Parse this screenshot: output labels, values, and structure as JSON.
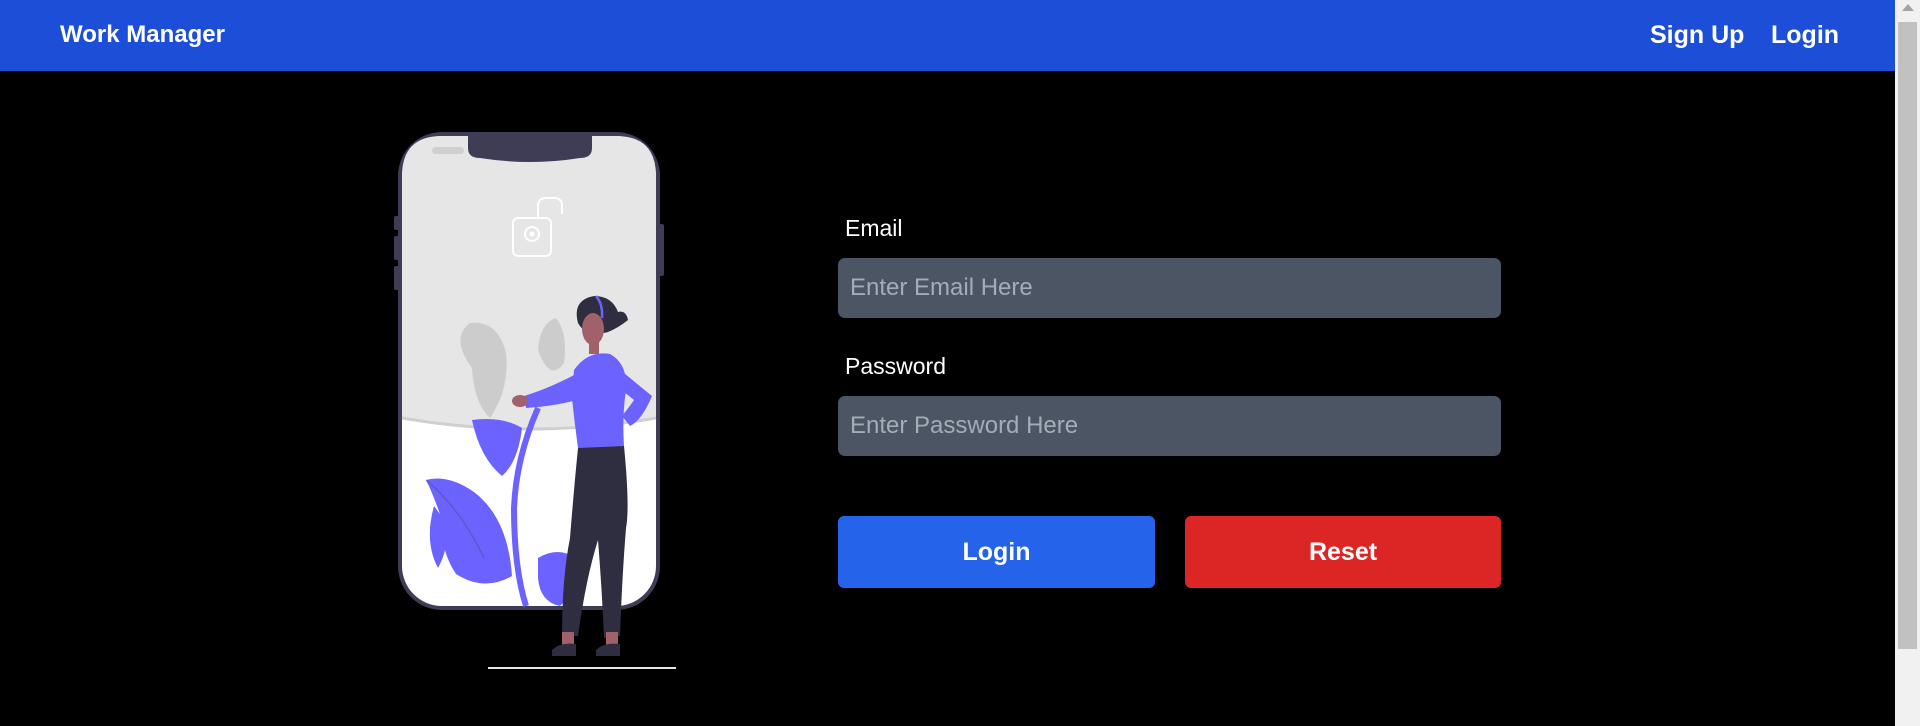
{
  "navbar": {
    "brand": "Work Manager",
    "links": {
      "signup": "Sign Up",
      "login": "Login"
    }
  },
  "form": {
    "email": {
      "label": "Email",
      "placeholder": "Enter Email Here",
      "value": ""
    },
    "password": {
      "label": "Password",
      "placeholder": "Enter Password Here",
      "value": ""
    },
    "buttons": {
      "login": "Login",
      "reset": "Reset"
    }
  },
  "illustration": {
    "icon": "unlocked-padlock-icon",
    "subject": "woman standing beside a smartphone"
  },
  "colors": {
    "navbar": "#1d4ed8",
    "background": "#000000",
    "input": "#4b5563",
    "login_button": "#2563eb",
    "reset_button": "#dc2626",
    "illustration_accent": "#6c63ff",
    "illustration_dark": "#2f2e41"
  }
}
